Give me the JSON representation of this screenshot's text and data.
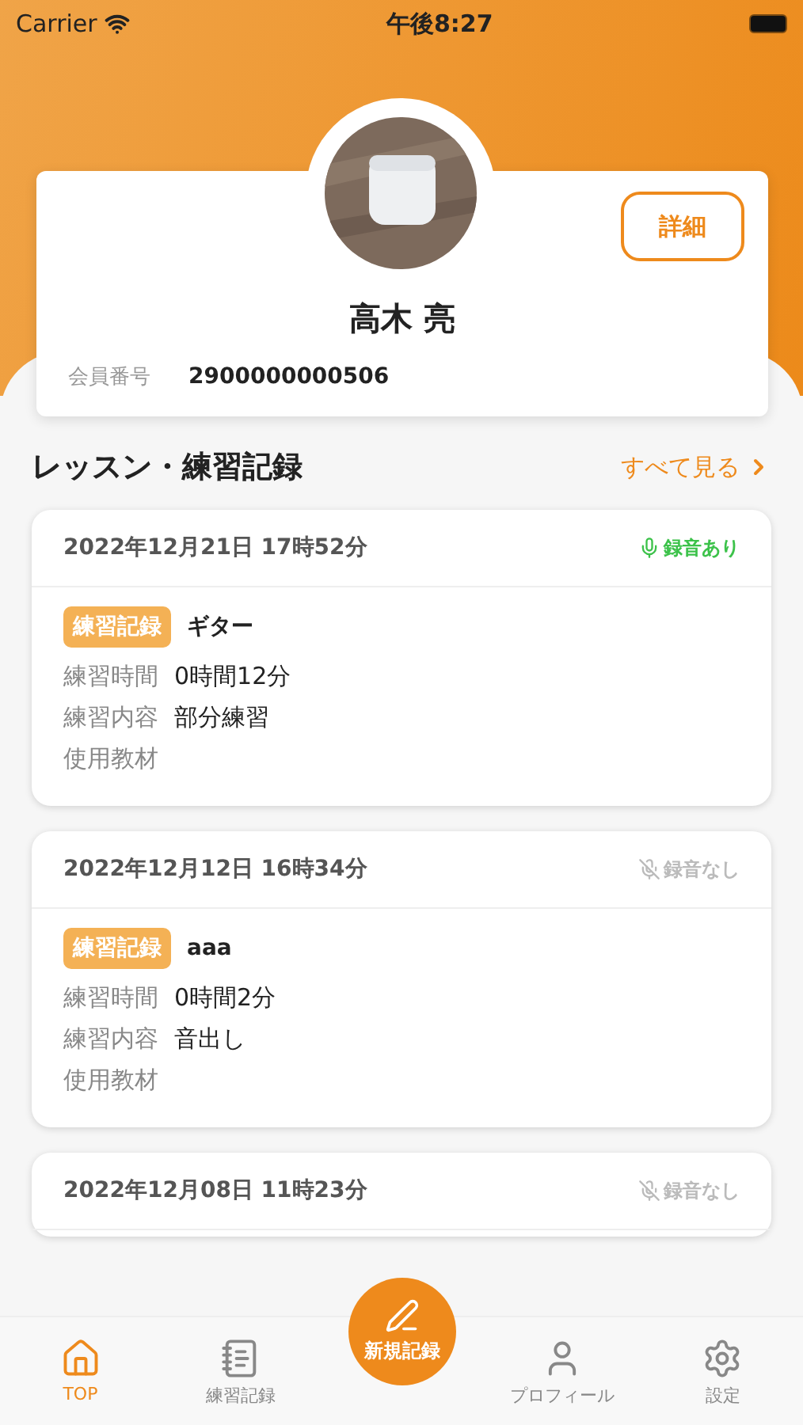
{
  "status_bar": {
    "carrier": "Carrier",
    "time": "午後8:27"
  },
  "profile": {
    "detail_button": "詳細",
    "name": "高木 亮",
    "member_label": "会員番号",
    "member_number": "2900000000506"
  },
  "records_section": {
    "title": "レッスン・練習記録",
    "see_all": "すべて見る"
  },
  "records": [
    {
      "datetime": "2022年12月21日 17時52分",
      "recording": true,
      "recording_label": "録音あり",
      "tag": "練習記録",
      "instrument": "ギター",
      "fields": [
        {
          "label": "練習時間",
          "value": "0時間12分"
        },
        {
          "label": "練習内容",
          "value": "部分練習"
        },
        {
          "label": "使用教材"
        }
      ]
    },
    {
      "datetime": "2022年12月12日 16時34分",
      "recording": false,
      "recording_label": "録音なし",
      "tag": "練習記録",
      "instrument": "aaa",
      "fields": [
        {
          "label": "練習時間",
          "value": "0時間2分"
        },
        {
          "label": "練習内容",
          "value": "音出し"
        },
        {
          "label": "使用教材"
        }
      ]
    },
    {
      "datetime": "2022年12月08日 11時23分",
      "recording": false,
      "recording_label": "録音なし"
    }
  ],
  "new_record_button": "新規記録",
  "tab_bar": [
    {
      "label": "TOP",
      "selected": true
    },
    {
      "label": "練習記録",
      "selected": false
    },
    {
      "label": "プロフィール",
      "selected": false
    },
    {
      "label": "設定",
      "selected": false
    }
  ]
}
